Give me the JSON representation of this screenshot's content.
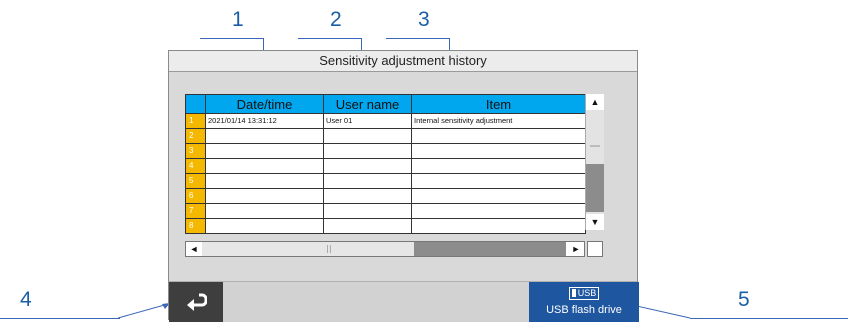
{
  "callouts": [
    "1",
    "2",
    "3",
    "4",
    "5"
  ],
  "window": {
    "title": "Sensitivity adjustment history"
  },
  "table": {
    "columns": [
      "",
      "Date/time",
      "User name",
      "Item"
    ],
    "rows": [
      {
        "num": "1",
        "datetime": "2021/01/14   13:31:12",
        "user": "User 01",
        "item": "Internal sensitivity adjustment"
      },
      {
        "num": "2",
        "datetime": "",
        "user": "",
        "item": ""
      },
      {
        "num": "3",
        "datetime": "",
        "user": "",
        "item": ""
      },
      {
        "num": "4",
        "datetime": "",
        "user": "",
        "item": ""
      },
      {
        "num": "5",
        "datetime": "",
        "user": "",
        "item": ""
      },
      {
        "num": "6",
        "datetime": "",
        "user": "",
        "item": ""
      },
      {
        "num": "7",
        "datetime": "",
        "user": "",
        "item": ""
      },
      {
        "num": "8",
        "datetime": "",
        "user": "",
        "item": ""
      }
    ]
  },
  "scroll": {
    "up": "▲",
    "down": "▼",
    "left": "◄",
    "right": "►"
  },
  "buttons": {
    "usb_badge": "USB",
    "usb_label": "USB flash drive",
    "back_icon": "return-arrow-icon"
  },
  "colors": {
    "header": "#00a6ee",
    "row_number": "#f5b800",
    "usb_button": "#1e56a0",
    "back_button": "#3e3e3e",
    "callout": "#1a5ea8"
  }
}
